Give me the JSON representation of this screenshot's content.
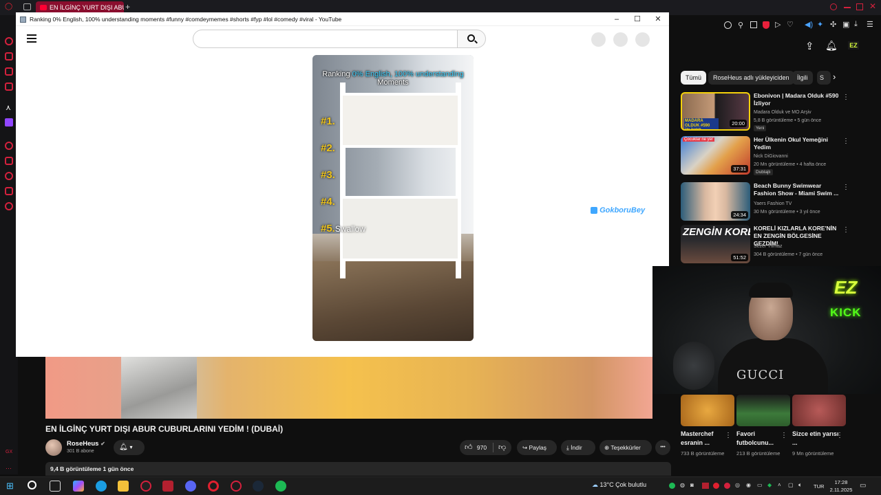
{
  "browser": {
    "tab_title": "EN İLGİNÇ YURT DIŞI ABU",
    "new_tab": "+"
  },
  "popup": {
    "title": "Ranking 0% English, 100% understanding moments #funny #comdeymemes #shorts #fyp #lol #comedy #viral - YouTube",
    "minimize": "–",
    "maximize": "☐",
    "close": "✕"
  },
  "short": {
    "title_pre": "Ranking ",
    "title_highlight": "0% English, 100% understanding",
    "title_post": "Moments",
    "ranks": [
      "#1.",
      "#2.",
      "#3.",
      "#4.",
      "#5."
    ],
    "rank5_label": "Swallow"
  },
  "overlay": {
    "streamer_tag": "GokboruBey"
  },
  "sidebar_topics": [
    "Tümü",
    "RoseHeus adlı yükleyiciden",
    "İlgili",
    "S"
  ],
  "related": [
    {
      "title": "Ebonivon | Madara Olduk #590 İzliyor",
      "channel": "Madara Olduk ve MO Arşiv",
      "meta": "5,8 B görüntüleme • 5 gün önce",
      "badge": "Yeni",
      "duration": "20:00",
      "thumb_text": "MADARA OLDUK #590 İZLİYOR"
    },
    {
      "title": "Her Ülkenin Okul Yemeğini Yedim",
      "channel": "Nick DiGiovanni",
      "meta": "20 Mn görüntüleme • 4 hafta önce",
      "badge": "Dublajlı",
      "duration": "37:31",
      "thumb_text": "Çocuklar ne yer"
    },
    {
      "title": "Beach Bunny Swimwear Fashion Show - Miami Swim ...",
      "channel": "Yaers Fashion TV",
      "meta": "30 Mn görüntüleme • 3 yıl önce",
      "badge": "",
      "duration": "24:34",
      "thumb_text": ""
    },
    {
      "title": "KORELİ KIZLARLA KORE'NİN EN ZENGİN BÖLGESİNE GEZDİM!",
      "channel": "Sezer Yılmaz",
      "meta": "304 B görüntüleme • 7 gün önce",
      "badge": "",
      "duration": "51:52",
      "thumb_text": "ZENGİN KORE"
    }
  ],
  "webcam": {
    "brand_ez": "EZ",
    "brand_kick": "KICK",
    "shirt_text": "GUCCI"
  },
  "video": {
    "title": "EN İLGİNÇ YURT DIŞI ABUR CUBURLARINI YEDİM ! (DUBAİ)",
    "channel": "RoseHeus",
    "subscribers": "301 B abone",
    "likes": "970",
    "share": "Paylaş",
    "download": "İndir",
    "thanks": "Teşekkürler",
    "more": "•••",
    "views_line": "9,4 B görüntüleme  1 gün önce"
  },
  "compact": [
    {
      "title": "Masterchef esranin ...",
      "meta": "733 B görüntüleme"
    },
    {
      "title": "Favori futbolcunu...",
      "meta": "213 B görüntüleme"
    },
    {
      "title": "Sizce etin yarısı ...",
      "meta": "9 Mn görüntüleme"
    }
  ],
  "taskbar": {
    "weather": "13°C  Çok bulutlu",
    "lang": "TUR",
    "time": "17:28",
    "date": "2.11.2025"
  },
  "colors": {
    "yt_red": "#ff0033",
    "opera_red": "#d4213d",
    "kick_green": "#53fc18"
  }
}
